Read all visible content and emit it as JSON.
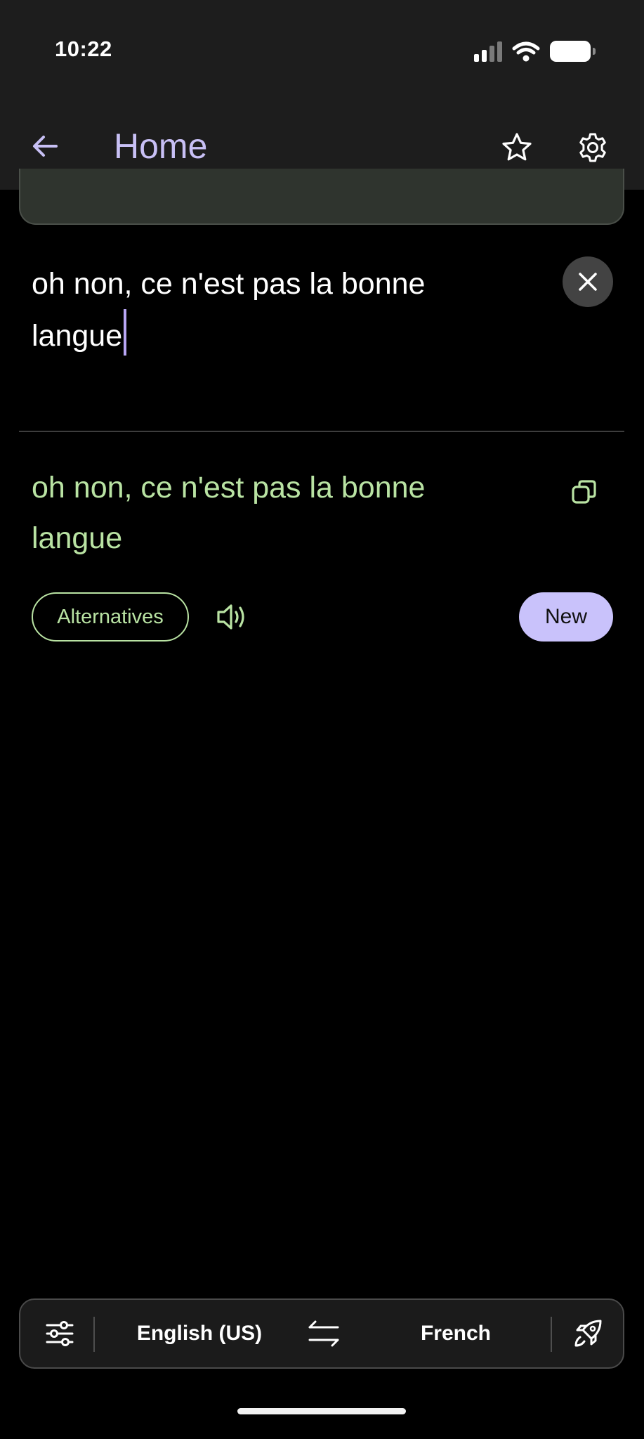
{
  "status_bar": {
    "time": "10:22",
    "icons": [
      "signal-icon",
      "wifi-icon",
      "battery-icon"
    ]
  },
  "header": {
    "title": "Home",
    "back_icon": "arrow-left-icon",
    "favorite_icon": "star-icon",
    "settings_icon": "gear-icon"
  },
  "source": {
    "text": "oh non, ce n'est pas la bonne langue",
    "clear_icon": "close-icon"
  },
  "translation": {
    "text": "oh non, ce n'est pas la bonne langue",
    "copy_icon": "copy-icon"
  },
  "actions": {
    "alternatives_label": "Alternatives",
    "speaker_icon": "speaker-icon",
    "new_label": "New"
  },
  "language_bar": {
    "source_language": "English (US)",
    "target_language": "French",
    "filter_icon": "sliders-icon",
    "swap_icon": "swap-icon",
    "rocket_icon": "rocket-icon"
  },
  "colors": {
    "accent_purple": "#c8c0f5",
    "translation_green": "#b9e3a3",
    "header_bg": "#1d1d1d",
    "page_bg": "#000000"
  }
}
